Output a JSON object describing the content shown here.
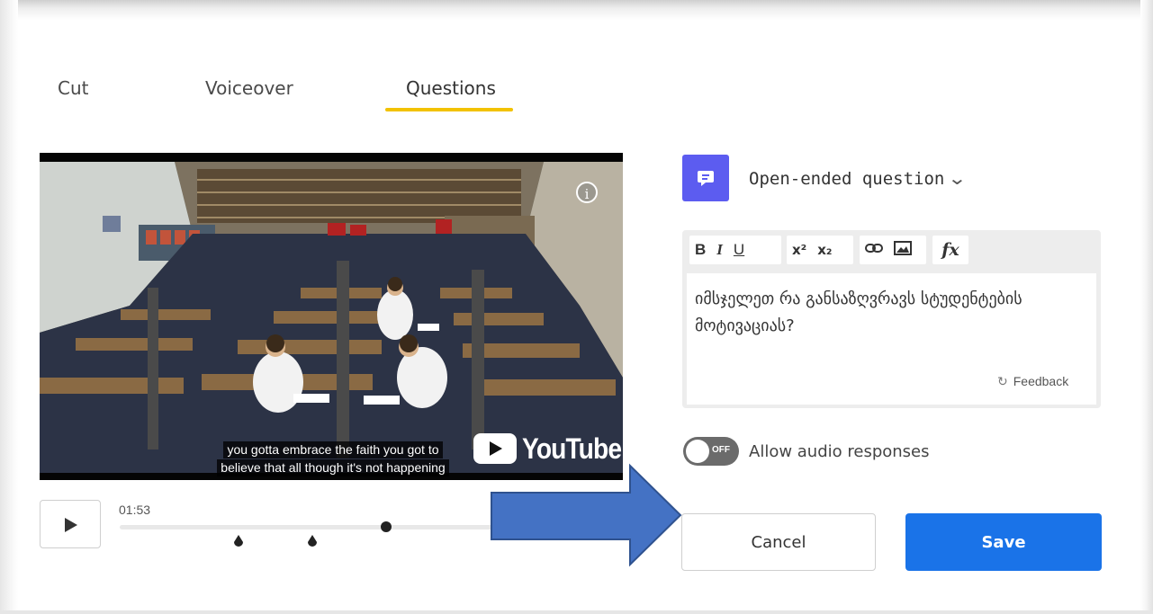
{
  "tabs": [
    {
      "label": "Cut",
      "active": false
    },
    {
      "label": "Voiceover",
      "active": false
    },
    {
      "label": "Questions",
      "active": true
    }
  ],
  "accent_color": "#f2c200",
  "video": {
    "subtitle_line1": "you gotta embrace the faith you got to",
    "subtitle_line2": "believe that all though it's not happening",
    "brand": "YouTube",
    "info_icon": "i"
  },
  "player": {
    "current_time": "01:53",
    "play_icon": "play-icon"
  },
  "question": {
    "type_label": "Open-ended question",
    "type_icon": "comment-icon",
    "type_icon_color": "#5c5cf0",
    "toolbar": {
      "bold": "B",
      "italic": "I",
      "underline": "U",
      "superscript": "x²",
      "subscript": "x₂",
      "formula": "fx"
    },
    "text": "იმსჯელეთ რა განსაზღვრავს სტუდენტების მოტივაციას?",
    "feedback_label": "Feedback"
  },
  "audio_toggle": {
    "state": "OFF",
    "label": "Allow audio responses"
  },
  "buttons": {
    "cancel": "Cancel",
    "save": "Save",
    "save_color": "#1a73e8"
  }
}
